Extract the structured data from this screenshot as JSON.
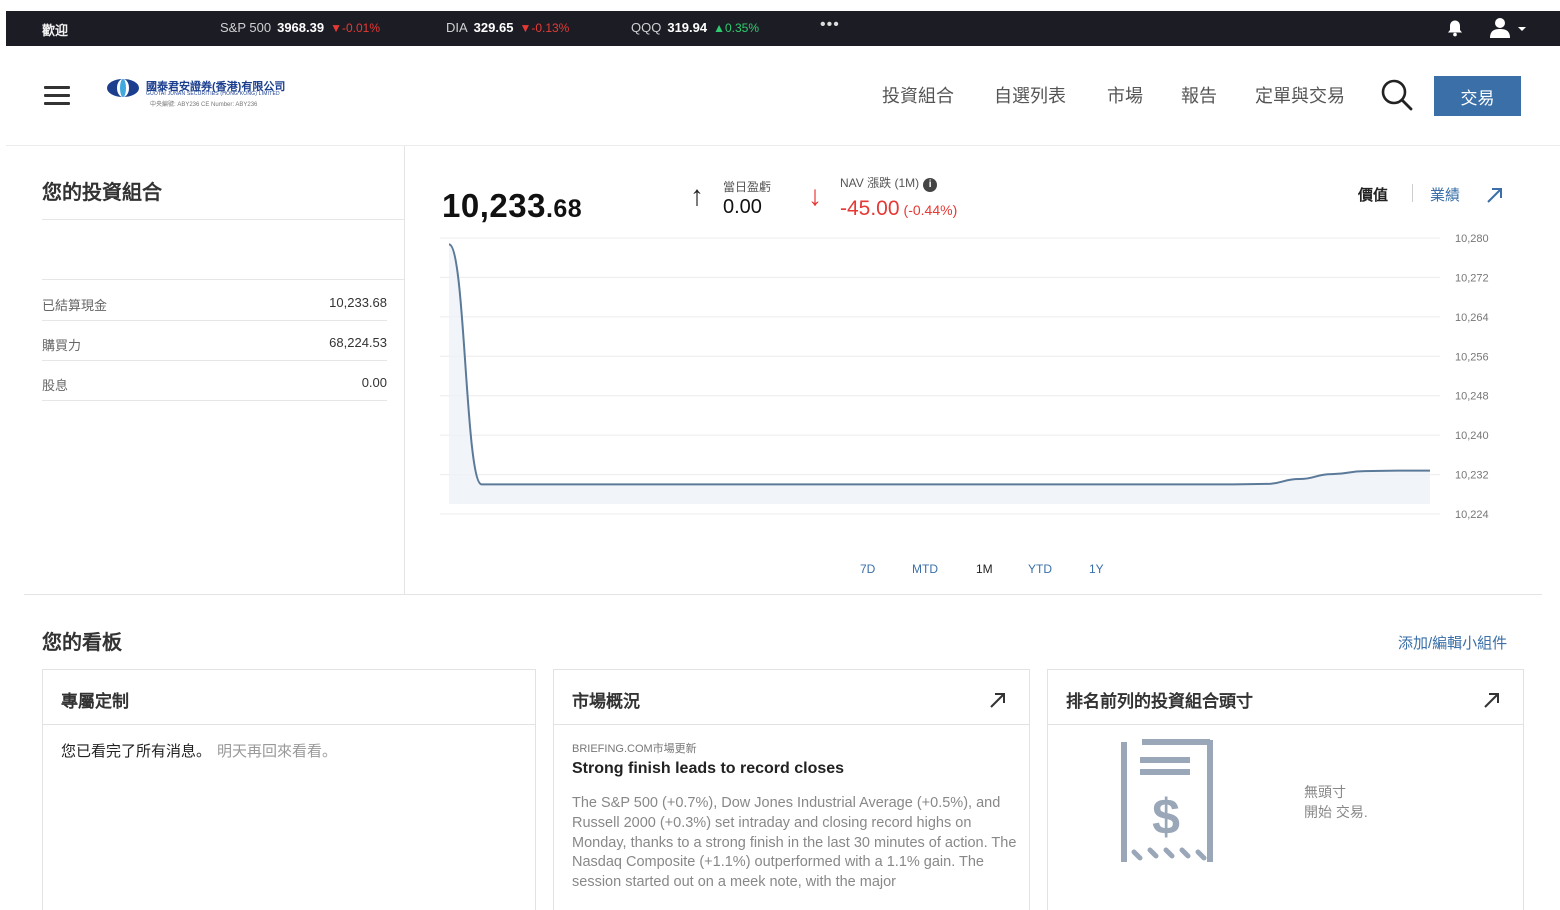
{
  "ticker": {
    "welcome": "歡迎",
    "items": [
      {
        "symbol": "S&P 500",
        "price": "3968.39",
        "change": "-0.01%",
        "direction": "down"
      },
      {
        "symbol": "DIA",
        "price": "329.65",
        "change": "-0.13%",
        "direction": "down"
      },
      {
        "symbol": "QQQ",
        "price": "319.94",
        "change": "0.35%",
        "direction": "up"
      }
    ],
    "more": "•••",
    "icons": [
      "bell-icon",
      "user-icon",
      "chevron-down-icon"
    ]
  },
  "header": {
    "logo_cn": "國泰君安證券(香港)有限公司",
    "logo_en": "GUOTAI JUNAN SECURITIES (HONG KONG) LIMITED",
    "logo_sub": "中央編號: ABY236   CE Number: ABY236",
    "nav": [
      "投資組合",
      "自選列表",
      "市場",
      "報告",
      "定單與交易"
    ],
    "trade_button": "交易"
  },
  "portfolio": {
    "title": "您的投資組合",
    "rows": [
      {
        "label": "已結算現金",
        "value": "10,233.68"
      },
      {
        "label": "購買力",
        "value": "68,224.53"
      },
      {
        "label": "股息",
        "value": "0.00"
      }
    ],
    "nav_int": "10,233",
    "nav_dec": ".68",
    "day_pl_label": "當日盈虧",
    "day_pl_value": "0.00",
    "nav_change_label": "NAV 漲跌 (1M)",
    "nav_change_value": "-45.00",
    "nav_change_pct": "(-0.44%)",
    "toggle_value": "價值",
    "toggle_performance": "業績",
    "ranges": [
      "7D",
      "MTD",
      "1M",
      "YTD",
      "1Y"
    ],
    "active_range": "1M"
  },
  "chart_data": {
    "type": "area",
    "y_ticks": [
      "10,280",
      "10,272",
      "10,264",
      "10,256",
      "10,248",
      "10,240",
      "10,232",
      "10,224"
    ],
    "ylim": [
      10224,
      10280
    ],
    "x": [
      0,
      1,
      2,
      3,
      4,
      5,
      6,
      7,
      8,
      9,
      10,
      11,
      12,
      13,
      14,
      15,
      16,
      17,
      18,
      19,
      20,
      21,
      22,
      23,
      24,
      25,
      26,
      27,
      28,
      29,
      30
    ],
    "values": [
      10278.7,
      10230,
      10230,
      10230,
      10230,
      10230,
      10230,
      10230,
      10230,
      10230,
      10230,
      10230,
      10230,
      10230,
      10230,
      10230,
      10230,
      10230,
      10230,
      10230,
      10230,
      10230,
      10230,
      10230,
      10230,
      10230.1,
      10231.1,
      10232.1,
      10232.7,
      10232.8,
      10232.8
    ],
    "color": "#5b7a99",
    "grid": true
  },
  "dashboard": {
    "title": "您的看板",
    "edit_link": "添加/編輯小組件",
    "custom": {
      "title": "專屬定制",
      "message": "您已看完了所有消息。",
      "message_sub": "明天再回來看看。"
    },
    "market": {
      "title": "市場概況",
      "source": "BRIEFING.COM市場更新",
      "headline": "Strong finish leads to record closes",
      "body": "The S&P 500 (+0.7%), Dow Jones Industrial Average (+0.5%), and Russell 2000 (+0.3%) set intraday and closing record highs on Monday, thanks to a strong finish in the last 30 minutes of action. The Nasdaq Composite (+1.1%) outperformed with a 1.1% gain. The session started out on a meek note, with the major"
    },
    "top_positions": {
      "title": "排名前列的投資組合頭寸",
      "empty_line1": "無頭寸",
      "empty_line2": "開始 交易."
    }
  },
  "colors": {
    "accent": "#3a6fa8",
    "negative": "#e53935",
    "positive": "#2ecc71",
    "ticker_bg": "#1c1d24"
  }
}
